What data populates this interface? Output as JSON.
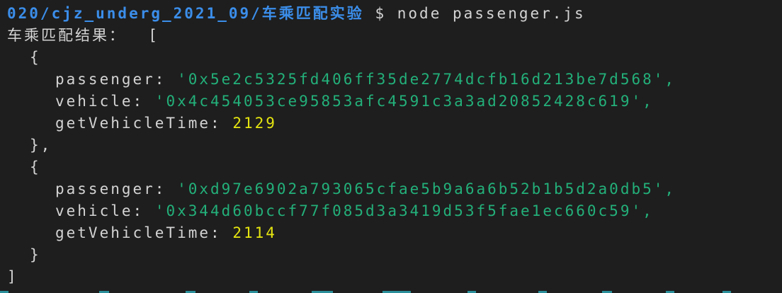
{
  "prompt": {
    "path": "020/cjz_underg_2021_09/车乘匹配实验",
    "symbol": "$",
    "command": "node passenger.js"
  },
  "output": {
    "label": "车乘匹配结果：",
    "open_bracket": "[",
    "close_bracket": "]",
    "entries": [
      {
        "open": "{",
        "passenger_key": "passenger:",
        "passenger": "'0x5e2c5325fd406ff35de2774dcfb16d213be7d568',",
        "vehicle_key": "vehicle:",
        "vehicle": "'0x4c454053ce95853afc4591c3a3ad20852428c619',",
        "time_key": "getVehicleTime:",
        "time": "2129",
        "close": "},"
      },
      {
        "open": "{",
        "passenger_key": "passenger:",
        "passenger": "'0xd97e6902a793065cfae5b9a6a6b52b1b5d2a0db5',",
        "vehicle_key": "vehicle:",
        "vehicle": "'0x344d60bccf77f085d3a3419d53f5fae1ec660c59',",
        "time_key": "getVehicleTime:",
        "time": "2114",
        "close": "}"
      }
    ]
  },
  "colors": {
    "background": "#1e1e1e",
    "prompt_path": "#3b8eea",
    "string": "#23b07a",
    "number": "#e5e510",
    "text": "#d4d4d4"
  }
}
